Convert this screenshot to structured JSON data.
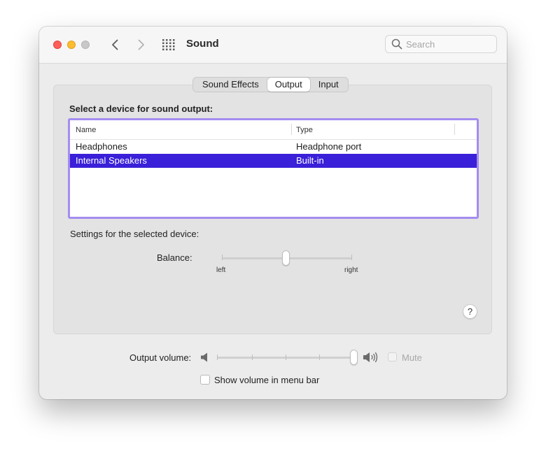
{
  "window": {
    "title": "Sound",
    "search_placeholder": "Search"
  },
  "tabs": [
    {
      "label": "Sound Effects",
      "selected": false
    },
    {
      "label": "Output",
      "selected": true
    },
    {
      "label": "Input",
      "selected": false
    }
  ],
  "output": {
    "heading": "Select a device for sound output:",
    "columns": [
      "Name",
      "Type"
    ],
    "devices": [
      {
        "name": "Headphones",
        "type": "Headphone port",
        "selected": false
      },
      {
        "name": "Internal Speakers",
        "type": "Built-in",
        "selected": true
      }
    ],
    "settings_label": "Settings for the selected device:",
    "balance_label": "Balance:",
    "balance_left": "left",
    "balance_right": "right",
    "balance_value": 0.5,
    "help_label": "?"
  },
  "volume": {
    "label": "Output volume:",
    "level": 1.0,
    "mute_label": "Mute",
    "mute_checked": false,
    "mute_enabled": false,
    "menu_bar_label": "Show volume in menu bar",
    "menu_bar_checked": false
  },
  "colors": {
    "selection": "#3a20d8",
    "focus_ring": "#a48cf0",
    "close": "#fe5f57",
    "minimize": "#febc2e"
  }
}
